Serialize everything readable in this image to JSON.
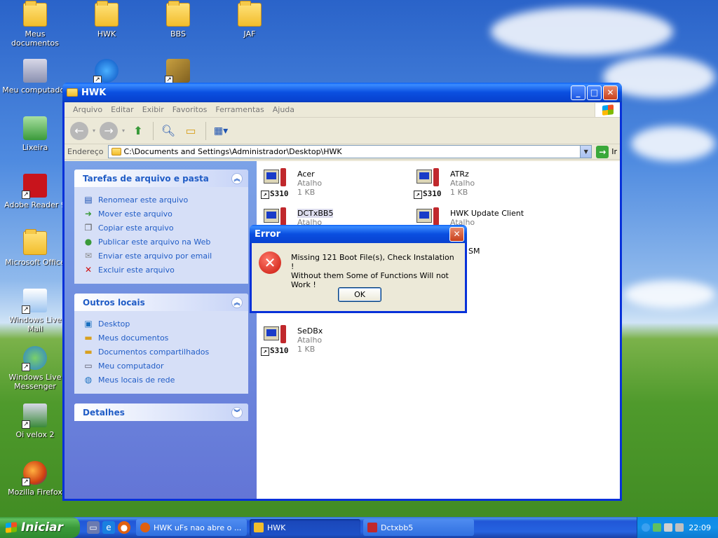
{
  "desktop": {
    "icons": [
      {
        "label": "Meus documentos"
      },
      {
        "label": "HWK"
      },
      {
        "label": "BBS"
      },
      {
        "label": "JAF"
      },
      {
        "label": "Meu computador"
      },
      {
        "label": "Lixeira"
      },
      {
        "label": "Adobe Reader 9"
      },
      {
        "label": "Microsoft Office"
      },
      {
        "label": "Windows Live Mail"
      },
      {
        "label": "Windows Live Messenger"
      },
      {
        "label": "Oi velox 2"
      },
      {
        "label": "Mozilla Firefox"
      }
    ]
  },
  "explorer": {
    "title": "HWK",
    "menu": [
      "Arquivo",
      "Editar",
      "Exibir",
      "Favoritos",
      "Ferramentas",
      "Ajuda"
    ],
    "address_label": "Endereço",
    "address_value": "C:\\Documents and Settings\\Administrador\\Desktop\\HWK",
    "go_label": "Ir",
    "panels": {
      "file_tasks": {
        "title": "Tarefas de arquivo e pasta",
        "items": [
          "Renomear este arquivo",
          "Mover este arquivo",
          "Copiar este arquivo",
          "Publicar este arquivo na Web",
          "Enviar este arquivo por email",
          "Excluir este arquivo"
        ]
      },
      "other_places": {
        "title": "Outros locais",
        "items": [
          "Desktop",
          "Meus documentos",
          "Documentos compartilhados",
          "Meu computador",
          "Meus locais de rede"
        ]
      },
      "details": {
        "title": "Detalhes"
      }
    },
    "files": [
      {
        "name": "Acer",
        "type": "Atalho",
        "size": "1 KB"
      },
      {
        "name": "ATRz",
        "type": "Atalho",
        "size": "1 KB"
      },
      {
        "name": "DCTxBB5",
        "type": "Atalho"
      },
      {
        "name": "HWK Update Client",
        "type": "Atalho"
      },
      {
        "name": "SeDBx",
        "type": "Atalho",
        "size": "1 KB"
      }
    ],
    "partial_text": "SM"
  },
  "dialog": {
    "title": "Error",
    "line1": "Missing 121 Boot File(s), Check Instalation !",
    "line2": "Without them Some of Functions Will not Work !",
    "ok_label": "OK"
  },
  "taskbar": {
    "start_label": "Iniciar",
    "tasks": [
      {
        "label": "HWK uFs nao abre o ..."
      },
      {
        "label": "HWK"
      },
      {
        "label": "Dctxbb5"
      }
    ],
    "clock": "22:09"
  },
  "colors": {
    "xp_blue": "#0831d9",
    "link_blue": "#215dc6",
    "start_green": "#3a9a3a"
  }
}
